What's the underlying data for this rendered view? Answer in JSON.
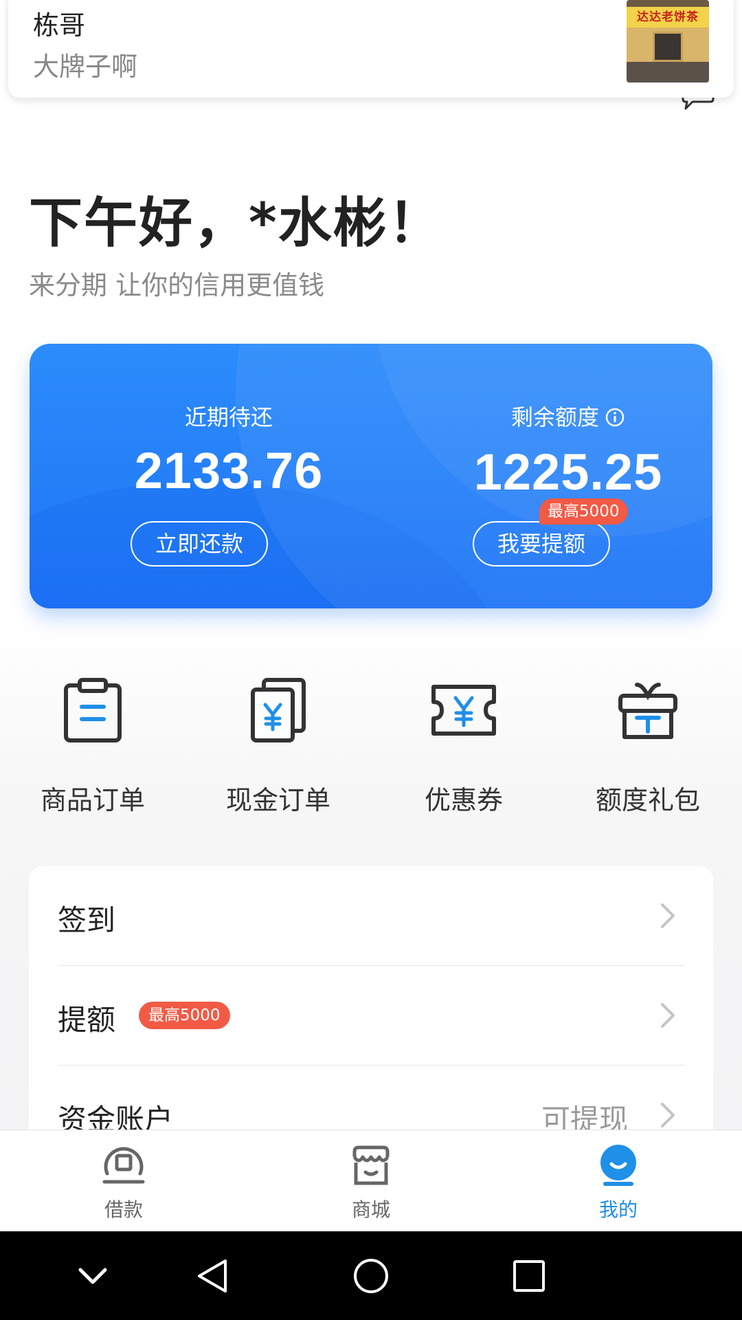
{
  "notification": {
    "title": "栋哥",
    "text": "大牌子啊",
    "thumb_sign": "达达老饼茶"
  },
  "greeting": {
    "title": "下午好，*水彬！",
    "slogan": "来分期 让你的信用更值钱"
  },
  "credit_card": {
    "repay_label": "近期待还",
    "repay_amount": "2133.76",
    "repay_button": "立即还款",
    "limit_label": "剩余额度",
    "limit_amount": "1225.25",
    "limit_button": "我要提额",
    "limit_badge": "最高5000",
    "info_icon": "info-icon",
    "accent_color": "#1e74f6"
  },
  "quick_actions": [
    {
      "label": "商品订单",
      "icon": "clipboard-icon"
    },
    {
      "label": "现金订单",
      "icon": "cash-document-icon"
    },
    {
      "label": "优惠券",
      "icon": "coupon-icon"
    },
    {
      "label": "额度礼包",
      "icon": "gift-icon"
    }
  ],
  "menu": {
    "items": [
      {
        "label": "签到"
      },
      {
        "label": "提额",
        "badge": "最高5000"
      },
      {
        "label": "资金账户",
        "right_text": "可提现"
      }
    ]
  },
  "tabbar": {
    "tabs": [
      {
        "label": "借款",
        "icon": "loan-icon"
      },
      {
        "label": "商城",
        "icon": "shop-icon"
      },
      {
        "label": "我的",
        "icon": "profile-icon",
        "active": true
      }
    ],
    "active_color": "#1f8fe8"
  },
  "system_nav": [
    "collapse-icon",
    "back-icon",
    "home-icon",
    "recents-icon"
  ]
}
